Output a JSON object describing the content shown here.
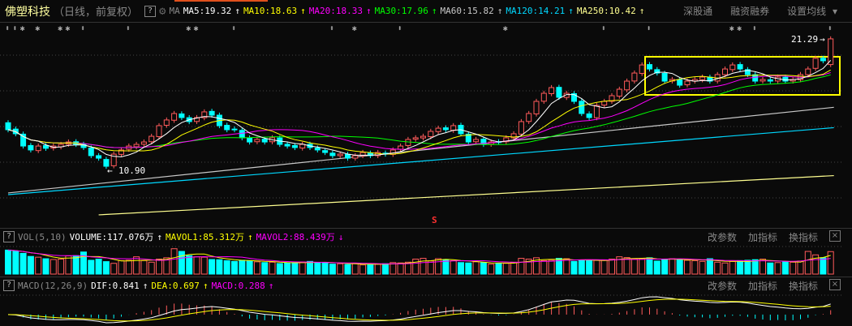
{
  "header": {
    "stock_name": "佛塑科技",
    "period": "（日线，前复权）",
    "help": "?",
    "ma_label": "MA",
    "ma": [
      {
        "text": "MA5:19.32",
        "arrow": "↑",
        "color": "#ffffff"
      },
      {
        "text": "MA10:18.63",
        "arrow": "↑",
        "color": "#ffff00"
      },
      {
        "text": "MA20:18.33",
        "arrow": "↑",
        "color": "#ff00ff"
      },
      {
        "text": "MA30:17.96",
        "arrow": "↑",
        "color": "#00ff00"
      },
      {
        "text": "MA60:15.82",
        "arrow": "↑",
        "color": "#c8c8c8"
      },
      {
        "text": "MA120:14.21",
        "arrow": "↑",
        "color": "#00d8ff"
      },
      {
        "text": "MA250:10.42",
        "arrow": "↑",
        "color": "#ffff90"
      }
    ],
    "buttons": [
      "深股通",
      "融资融券",
      "设置均线"
    ]
  },
  "annotations": {
    "high_label": "21.29",
    "low_label": "10.90",
    "signal": "S"
  },
  "volume_panel": {
    "help": "?",
    "name": "VOL(5,10)",
    "volume": "VOLUME:117.076万",
    "volume_arrow": "↑",
    "mavol1": "MAVOL1:85.312万",
    "mavol1_arrow": "↑",
    "mavol2": "MAVOL2:88.439万",
    "mavol2_arrow": "↓",
    "buttons": [
      "改参数",
      "加指标",
      "换指标"
    ],
    "close": "×"
  },
  "macd_panel": {
    "help": "?",
    "name": "MACD(12,26,9)",
    "dif": "DIF:0.841",
    "dif_arrow": "↑",
    "dea": "DEA:0.697",
    "dea_arrow": "↑",
    "macd": "MACD:0.288",
    "macd_arrow": "↑",
    "buttons": [
      "改参数",
      "加指标",
      "换指标"
    ],
    "close": "×"
  },
  "colors": {
    "up": "#ff5a5a",
    "down": "#00ffff",
    "ma5": "#ffffff",
    "ma10": "#ffff00",
    "ma20": "#ff00ff",
    "ma30": "#00ff00",
    "ma60": "#c8c8c8",
    "ma120": "#00d8ff",
    "ma250": "#ffff90",
    "highlight": "#ffff00"
  },
  "chart_data": {
    "type": "candlestick",
    "price_range": [
      7.0,
      22.4
    ],
    "close": [
      14.05,
      13.73,
      12.76,
      12.45,
      12.76,
      12.58,
      12.76,
      12.89,
      13.08,
      12.89,
      12.64,
      12.0,
      11.8,
      11.16,
      12.12,
      12.45,
      12.76,
      12.89,
      13.08,
      13.53,
      14.37,
      14.82,
      15.33,
      15.01,
      14.69,
      15.01,
      15.46,
      15.2,
      14.37,
      14.05,
      14.05,
      13.41,
      13.08,
      13.28,
      13.08,
      13.41,
      12.89,
      12.76,
      12.64,
      12.89,
      12.64,
      12.45,
      12.25,
      12.0,
      12.12,
      11.8,
      12.0,
      12.25,
      12.0,
      12.25,
      12.12,
      12.45,
      12.76,
      13.28,
      13.41,
      13.53,
      13.92,
      14.17,
      14.05,
      14.37,
      13.73,
      13.08,
      13.28,
      12.89,
      13.08,
      13.08,
      13.41,
      13.73,
      14.69,
      15.33,
      16.29,
      16.93,
      17.38,
      16.61,
      16.93,
      16.29,
      15.33,
      15.01,
      15.97,
      16.29,
      16.74,
      17.25,
      17.89,
      18.53,
      19.17,
      18.85,
      18.53,
      17.89,
      18.02,
      17.57,
      17.89,
      18.02,
      18.21,
      17.89,
      18.41,
      18.85,
      19.17,
      18.85,
      18.41,
      17.89,
      18.02,
      17.89,
      18.21,
      17.89,
      18.02,
      18.41,
      18.85,
      19.69,
      19.5,
      21.23
    ],
    "open": [
      14.6,
      14.1,
      13.7,
      12.8,
      12.4,
      12.8,
      12.6,
      12.7,
      12.9,
      13.1,
      12.9,
      12.6,
      12.0,
      11.7,
      11.2,
      12.1,
      12.5,
      12.7,
      12.9,
      13.1,
      13.5,
      14.4,
      14.8,
      15.3,
      15.0,
      14.7,
      15.0,
      15.5,
      15.2,
      14.4,
      14.1,
      14.0,
      13.4,
      13.1,
      13.3,
      13.1,
      13.4,
      12.9,
      12.8,
      12.6,
      12.9,
      12.6,
      12.4,
      12.2,
      12.0,
      12.1,
      11.8,
      12.0,
      12.2,
      12.0,
      12.2,
      12.1,
      12.5,
      12.8,
      13.3,
      13.4,
      13.5,
      13.9,
      14.2,
      14.0,
      14.4,
      13.7,
      13.1,
      13.3,
      12.9,
      13.1,
      13.1,
      13.4,
      13.7,
      14.7,
      15.3,
      16.3,
      16.9,
      17.4,
      16.6,
      16.9,
      16.3,
      15.3,
      15.0,
      16.0,
      16.3,
      16.7,
      17.2,
      17.9,
      18.5,
      19.2,
      18.8,
      18.5,
      17.9,
      18.0,
      17.6,
      17.9,
      18.0,
      18.2,
      17.9,
      18.4,
      18.8,
      19.2,
      18.8,
      18.4,
      17.9,
      18.0,
      17.9,
      18.2,
      17.9,
      18.0,
      18.4,
      18.9,
      19.7,
      19.2
    ],
    "volume": [
      125,
      120,
      108,
      92,
      88,
      80,
      76,
      78,
      95,
      96,
      115,
      72,
      78,
      65,
      56,
      70,
      72,
      90,
      70,
      62,
      78,
      85,
      132,
      118,
      96,
      90,
      88,
      76,
      75,
      70,
      66,
      72,
      70,
      64,
      60,
      62,
      55,
      58,
      60,
      63,
      66,
      58,
      60,
      52,
      54,
      50,
      55,
      48,
      50,
      52,
      54,
      60,
      58,
      62,
      78,
      82,
      68,
      80,
      76,
      70,
      60,
      58,
      64,
      60,
      52,
      55,
      56,
      62,
      82,
      78,
      85,
      70,
      72,
      82,
      80,
      66,
      70,
      70,
      72,
      74,
      78,
      90,
      86,
      78,
      80,
      85,
      68,
      75,
      80,
      78,
      72,
      70,
      66,
      80,
      62,
      58,
      66,
      70,
      72,
      75,
      78,
      58,
      60,
      65,
      62,
      68,
      118,
      100,
      85,
      117
    ]
  }
}
